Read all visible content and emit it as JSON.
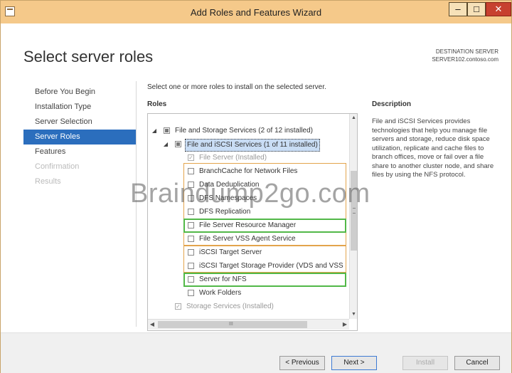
{
  "window": {
    "title": "Add Roles and Features Wizard",
    "min": "–",
    "max": "□",
    "close": "✕"
  },
  "header": {
    "page_title": "Select server roles",
    "destination_label": "DESTINATION SERVER",
    "destination_server": "SERVER102.contoso.com"
  },
  "nav": {
    "items": [
      {
        "label": "Before You Begin",
        "state": "normal"
      },
      {
        "label": "Installation Type",
        "state": "normal"
      },
      {
        "label": "Server Selection",
        "state": "normal"
      },
      {
        "label": "Server Roles",
        "state": "active"
      },
      {
        "label": "Features",
        "state": "normal"
      },
      {
        "label": "Confirmation",
        "state": "disabled"
      },
      {
        "label": "Results",
        "state": "disabled"
      }
    ]
  },
  "main": {
    "intro": "Select one or more roles to install on the selected server.",
    "roles_label": "Roles",
    "tree": [
      {
        "label": "File and Storage Services (2 of 12 installed)",
        "indent": 0,
        "arrow": "◢",
        "check": "partial"
      },
      {
        "label": "File and iSCSI Services (1 of 11 installed)",
        "indent": 1,
        "arrow": "◢",
        "check": "partial",
        "selected": true
      },
      {
        "label": "File Server (Installed)",
        "indent": 2,
        "check": "checked",
        "gray": true
      },
      {
        "label": "BranchCache for Network Files",
        "indent": 2,
        "check": "none"
      },
      {
        "label": "Data Deduplication",
        "indent": 2,
        "check": "none"
      },
      {
        "label": "DFS Namespaces",
        "indent": 2,
        "check": "none"
      },
      {
        "label": "DFS Replication",
        "indent": 2,
        "check": "none"
      },
      {
        "label": "File Server Resource Manager",
        "indent": 2,
        "check": "none"
      },
      {
        "label": "File Server VSS Agent Service",
        "indent": 2,
        "check": "none"
      },
      {
        "label": "iSCSI Target Server",
        "indent": 2,
        "check": "none"
      },
      {
        "label": "iSCSI Target Storage Provider (VDS and VSS",
        "indent": 2,
        "check": "none"
      },
      {
        "label": "Server for NFS",
        "indent": 2,
        "check": "none"
      },
      {
        "label": "Work Folders",
        "indent": 2,
        "check": "none"
      },
      {
        "label": "Storage Services (Installed)",
        "indent": 1,
        "check": "checked",
        "gray": true
      }
    ],
    "hscroll_grip": "III"
  },
  "description": {
    "title": "Description",
    "text": "File and iSCSI Services provides technologies that help you manage file servers and storage, reduce disk space utilization, replicate and cache files to branch offices, move or fail over a file share to another cluster node, and share files by using the NFS protocol."
  },
  "watermark": "Braindump2go.com",
  "footer": {
    "previous": "< Previous",
    "next": "Next >",
    "install": "Install",
    "cancel": "Cancel"
  },
  "colors": {
    "active_nav": "#2b6ebd",
    "title_bar": "#f5c98a",
    "green_highlight": "#52b848",
    "orange_highlight": "#e3a44c"
  }
}
